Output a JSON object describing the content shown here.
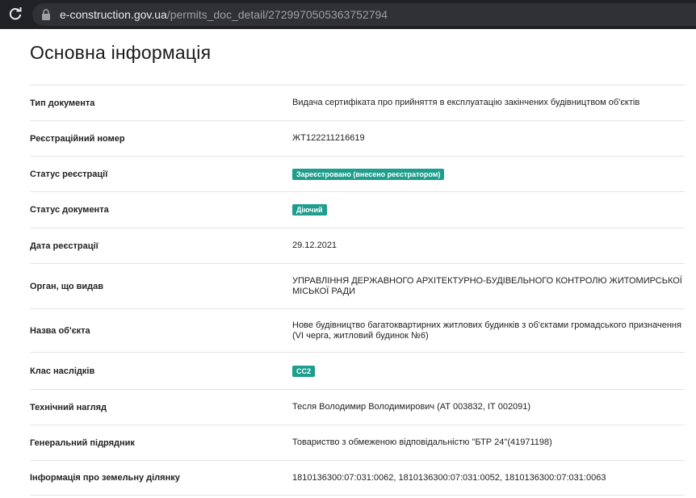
{
  "browser": {
    "url_host": "e-construction.gov.ua",
    "url_path": "/permits_doc_detail/2729970505363752794"
  },
  "page": {
    "title": "Основна інформація"
  },
  "rows": [
    {
      "label": "Тип документа",
      "value": "Видача сертифіката про прийняття в експлуатацію закінчених будівництвом об'єктів"
    },
    {
      "label": "Реєстраційний номер",
      "value": "ЖТ122211216619"
    },
    {
      "label": "Статус реєстрації",
      "badge": "Зареєстровано (внесено реєстратором)"
    },
    {
      "label": "Статус документа",
      "badge": "Діючий"
    },
    {
      "label": "Дата реєстрації",
      "value": "29.12.2021"
    },
    {
      "label": "Орган, що видав",
      "value": "УПРАВЛІННЯ ДЕРЖАВНОГО АРХІТЕКТУРНО-БУДІВЕЛЬНОГО КОНТРОЛЮ ЖИТОМИРСЬКОЇ МІСЬКОЇ РАДИ"
    },
    {
      "label": "Назва об'єкта",
      "value": "Нове будівництво багатоквартирних житлових будинків з об'єктами громадського призначення (VI черга, житловий будинок №6)"
    },
    {
      "label": "Клас наслідків",
      "badge": "СС2"
    },
    {
      "label": "Технічний нагляд",
      "value": "Тесля Володимир Володимирович (АТ 003832, ІТ 002091)"
    },
    {
      "label": "Генеральний підрядник",
      "value": "Товариство з обмеженою відповідальністю \"БТР 24\"(41971198)"
    },
    {
      "label": "Інформація про земельну ділянку",
      "value": "1810136300:07:031:0062, 1810136300:07:031:0052, 1810136300:07:031:0063"
    }
  ],
  "icons": {
    "reload": "reload-icon",
    "lock": "lock-icon"
  },
  "colors": {
    "badge": "#1f9e8e",
    "browser_bar": "#202124"
  }
}
